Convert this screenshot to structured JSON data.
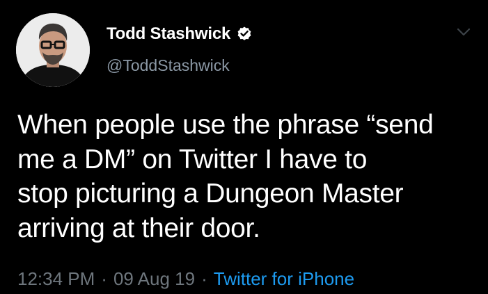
{
  "tweet": {
    "author": {
      "display_name": "Todd Stashwick",
      "handle": "@ToddStashwick",
      "verified": true,
      "avatar_icon": "avatar-photo"
    },
    "text_lines": [
      "When people use the phrase “send",
      "me a DM” on Twitter I have to",
      "stop picturing a Dungeon Master",
      "arriving at their door."
    ],
    "time": "12:34 PM",
    "separator": "·",
    "date": "09 Aug 19",
    "source": "Twitter for iPhone",
    "menu_icon": "chevron-down-icon"
  },
  "colors": {
    "background": "#000000",
    "text": "#ffffff",
    "handle": "#8b98a5",
    "meta": "#6e767d",
    "link": "#1d9bf0"
  }
}
